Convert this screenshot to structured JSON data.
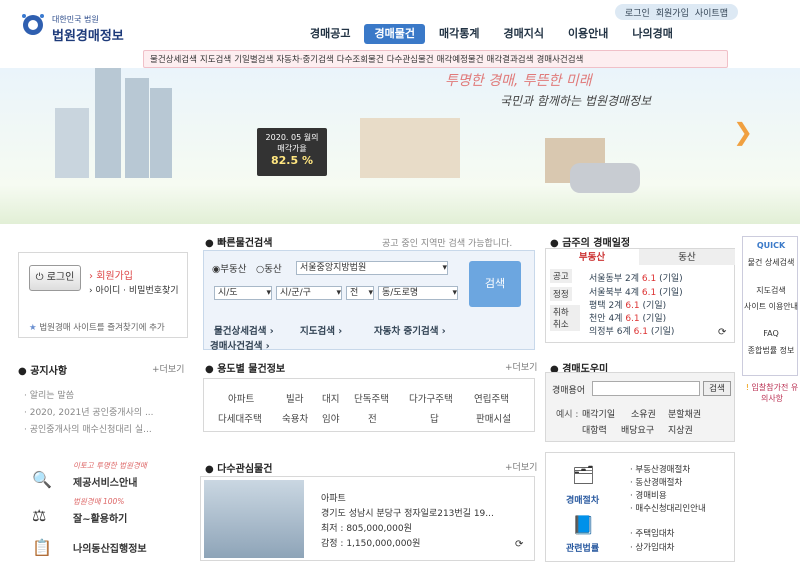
{
  "logo": {
    "line1": "대한민국 법원",
    "line2": "법원경매정보"
  },
  "topnav": [
    "로그인",
    "회원가입",
    "사이트맵"
  ],
  "mainnav": [
    "경매공고",
    "경매물건",
    "매각통계",
    "경매지식",
    "이용안내",
    "나의경매"
  ],
  "subnav": [
    "물건상세검색",
    "지도검색",
    "기일별검색",
    "자동차·중기검색",
    "다수조회물건",
    "다수관심물건",
    "매각예정물건",
    "매각결과검색",
    "경매사건검색"
  ],
  "banner": {
    "slogan1": "투명한 경매, 투뜬한 미래",
    "slogan2": "국민과 함께하는 법원경매정보",
    "board_line1": "2020. 05 월의",
    "board_line2": "매각가율",
    "board_value": "82.5 %"
  },
  "login": {
    "button": "로그인",
    "join": "회원가입",
    "find": "아이디 · 비밀번호찾기",
    "favorite": "법원경매 사이트를 즐겨찾기에 추가"
  },
  "notice": {
    "title": "공지사항",
    "more": "더보기",
    "items": [
      "알리는 말씀",
      "2020, 2021년 공인중개사의 ...",
      "공인중개사의 매수신청대리 실..."
    ]
  },
  "promos": [
    "제공서비스안내",
    "잘~활용하기",
    "나의동산집행정보"
  ],
  "promo_captions": [
    "이토고 투명한 법원경매",
    "법원경매 100%"
  ],
  "quick": {
    "title": "빠른물건검색",
    "hint": "공고 중인 지역만 검색 가능합니다.",
    "radio1": "부동산",
    "radio2": "동산",
    "court": "서울중앙지방법원",
    "sido": "시/도",
    "sigungu": "시/군/구",
    "jeon": "전",
    "dong": "동/도로명",
    "search": "검색",
    "links": [
      "물건상세검색",
      "지도검색",
      "자동차 중기검색",
      "경매사건검색"
    ]
  },
  "types": {
    "title": "용도별 물건정보",
    "more": "더보기",
    "row1": [
      "아파트",
      "빌라",
      "대지",
      "단독주택",
      "다가구주택",
      "연립주택"
    ],
    "row2": [
      "다세대주택",
      "숙용차",
      "임야",
      "전",
      "답",
      "판매시설"
    ]
  },
  "hot": {
    "title": "다수관심물건",
    "more": "더보기",
    "lines": [
      "아파트",
      "경기도 성남시 분당구 정자일로213번길 19...",
      "최저 : 805,000,000원",
      "감정 : 1,150,000,000원"
    ]
  },
  "schedule": {
    "title": "금주의 경매일정",
    "tab1": "부동산",
    "tab2": "동산",
    "side": [
      "공고",
      "정정",
      "취하 취소"
    ],
    "items": [
      {
        "court": "서울동부",
        "count": "2계",
        "date": "6.1",
        "tag": "(기일)"
      },
      {
        "court": "서울북부",
        "count": "4계",
        "date": "6.1",
        "tag": "(기일)"
      },
      {
        "court": "평택",
        "count": "2계",
        "date": "6.1",
        "tag": "(기일)"
      },
      {
        "court": "천안",
        "count": "4계",
        "date": "6.1",
        "tag": "(기일)"
      },
      {
        "court": "의정부",
        "count": "6계",
        "date": "6.1",
        "tag": "(기일)"
      }
    ]
  },
  "help": {
    "title": "경매도우미",
    "label": "경매용어",
    "search": "검색",
    "ex_label": "예시 :",
    "examples": [
      "매각기일",
      "소유권",
      "분할채권",
      "대항력",
      "배당요구",
      "지상권"
    ]
  },
  "guide": {
    "left1": "경매절차",
    "left2": "관련법률",
    "items": [
      "부동산경매절차",
      "동산경매절차",
      "경매비용",
      "매수신청대리인안내",
      "주택임대차",
      "상가임대차"
    ]
  },
  "quick_panel": {
    "title": "QUICK",
    "items": [
      "물건 상세검색",
      "지도검색",
      "사이트 이용안내",
      "FAQ",
      "종합법률 정보"
    ]
  },
  "warn": "입찰참가전 유의사항"
}
